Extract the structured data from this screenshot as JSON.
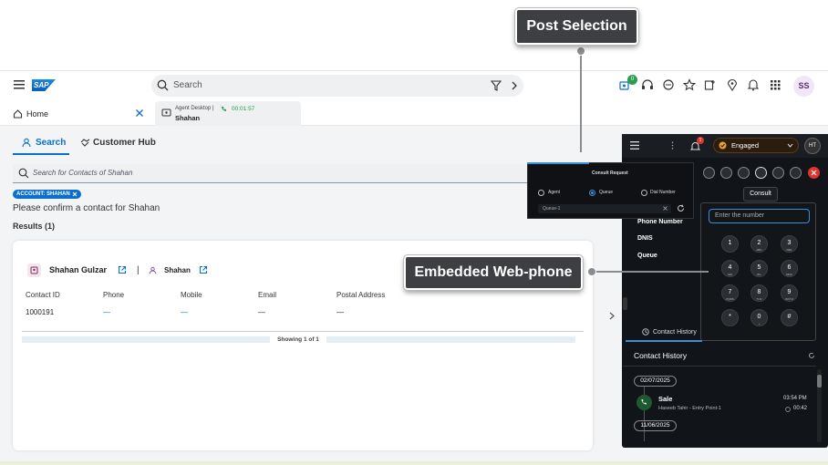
{
  "annotations": {
    "post_selection": "Post Selection",
    "embedded_webphone": "Embedded Web-phone"
  },
  "header": {
    "logo": "SAP",
    "search_placeholder": "Search",
    "notification_count": "0",
    "avatar_initials": "SS"
  },
  "tabs": {
    "home": "Home",
    "agent_desktop": "Agent Desktop |",
    "agent_timer": "00:01:57",
    "agent_name": "Shahan"
  },
  "subtabs": {
    "search": "Search",
    "customer_hub": "Customer Hub"
  },
  "contact_search": {
    "placeholder": "Search for Contacts of Shahan",
    "token": "ACCOUNT: SHAHAN"
  },
  "results": {
    "prompt": "Please confirm a contact for Shahan",
    "count": "Results (1)",
    "contact_name": "Shahan Gulzar",
    "account_name": "Shahan",
    "separator": "|",
    "columns": [
      "Contact ID",
      "Phone",
      "Mobile",
      "Email",
      "Postal Address"
    ],
    "row": [
      "1000191",
      "—",
      "—",
      "—",
      "—"
    ],
    "showing": "Showing 1 of 1"
  },
  "webphone": {
    "status": "Engaged",
    "badge": "1",
    "avatar": "HT",
    "consult_tooltip": "Consult",
    "number_placeholder": "Enter the number",
    "keys": [
      {
        "d": "1",
        "s": ""
      },
      {
        "d": "2",
        "s": "ABC"
      },
      {
        "d": "3",
        "s": "DEF"
      },
      {
        "d": "4",
        "s": "GHI"
      },
      {
        "d": "5",
        "s": "JKL"
      },
      {
        "d": "6",
        "s": "MNO"
      },
      {
        "d": "7",
        "s": "PQRS"
      },
      {
        "d": "8",
        "s": "TUV"
      },
      {
        "d": "9",
        "s": "WXYZ"
      },
      {
        "d": "*",
        "s": ""
      },
      {
        "d": "0",
        "s": "+"
      },
      {
        "d": "#",
        "s": ""
      }
    ],
    "labels": {
      "phone_number": "Phone Number",
      "dnis": "DNIS",
      "queue": "Queue"
    },
    "consult_request": {
      "title": "Consult Request",
      "options": [
        "Agent",
        "Queue",
        "Dial Number"
      ],
      "selected": "Queue",
      "queue_value": "Queue-1"
    },
    "contact_history_tab": "Contact History",
    "contact_history_title": "Contact History",
    "history": [
      {
        "date": "02/07/2025",
        "type": "Sale",
        "detail": "Haseeb Tahir - Entry Point-1",
        "time": "03:54 PM",
        "duration": "00:42"
      },
      {
        "date": "11/06/2025"
      }
    ]
  },
  "colors": {
    "accent": "#0a6ed1",
    "engaged": "#e8a13a",
    "end_call": "#e0332f",
    "callout_bg": "#3d3f42"
  }
}
